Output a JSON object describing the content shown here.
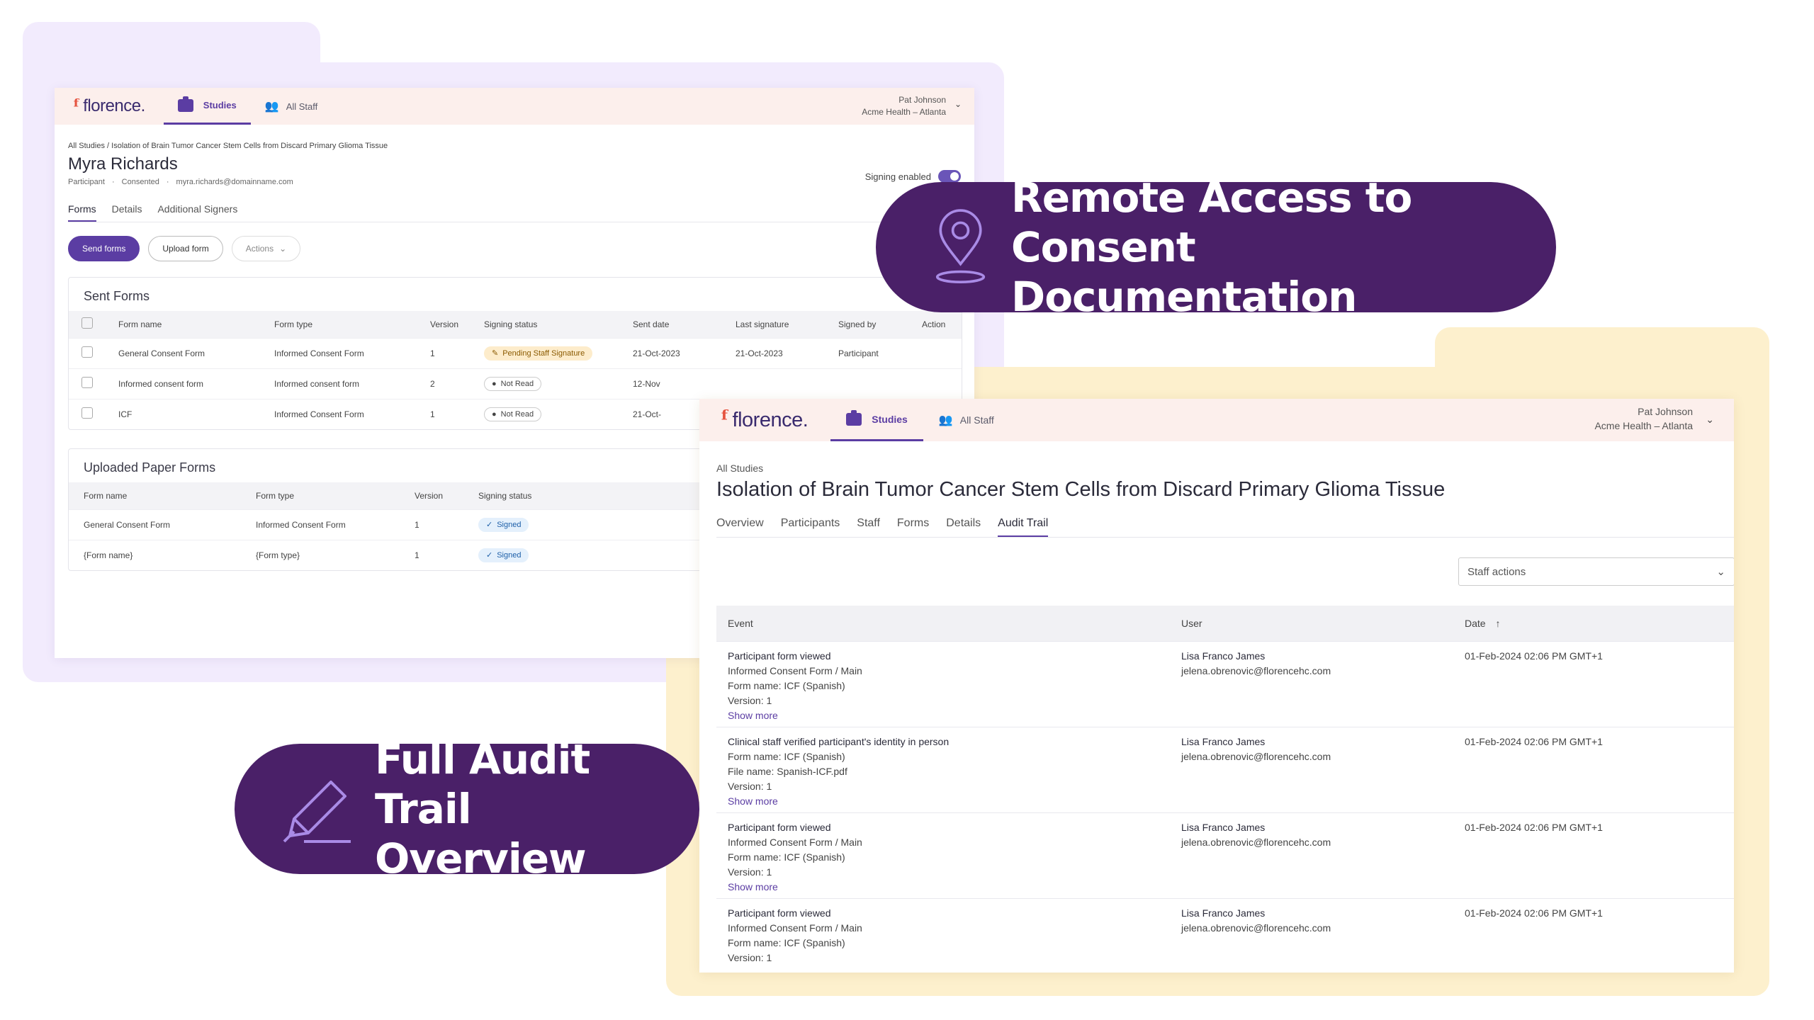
{
  "callouts": {
    "remote_line1": "Remote Access to Consent",
    "remote_line2": "Documentation",
    "audit_line1": "Full Audit Trail",
    "audit_line2": "Overview"
  },
  "colors": {
    "brand_purple": "#5b3da3",
    "callout_bg": "#4a2068",
    "header_bg": "#fcefec",
    "backdrop_purple": "#f2ebfd",
    "backdrop_yellow": "#fdf0cd"
  },
  "participant_window": {
    "logo": "florence.",
    "tabs": {
      "studies": "Studies",
      "staff": "All Staff"
    },
    "user": {
      "name": "Pat Johnson",
      "org": "Acme Health – Atlanta"
    },
    "breadcrumb": "All Studies / Isolation of Brain Tumor Cancer Stem Cells from Discard Primary Glioma Tissue",
    "name": "Myra Richards",
    "meta": [
      "Participant",
      "Consented",
      "myra.richards@domainname.com"
    ],
    "meta_sep": "·",
    "signing_label": "Signing enabled",
    "subtabs": [
      "Forms",
      "Details",
      "Additional Signers"
    ],
    "buttons": {
      "send": "Send forms",
      "upload": "Upload form",
      "actions": "Actions"
    },
    "sent_forms": {
      "title": "Sent Forms",
      "headers": [
        "Form name",
        "Form type",
        "Version",
        "Signing status",
        "Sent date",
        "Last signature",
        "Signed by",
        "Action"
      ],
      "rows": [
        {
          "name": "General Consent Form",
          "type": "Informed Consent Form",
          "version": "1",
          "status": "Pending Staff Signature",
          "sent": "21-Oct-2023",
          "last": "21-Oct-2023",
          "signed_by": "Participant"
        },
        {
          "name": "Informed consent form",
          "type": "Informed consent form",
          "version": "2",
          "status": "Not Read",
          "sent": "12-Nov",
          "last": "",
          "signed_by": ""
        },
        {
          "name": "ICF",
          "type": "Informed Consent Form",
          "version": "1",
          "status": "Not Read",
          "sent": "21-Oct-",
          "last": "",
          "signed_by": ""
        }
      ]
    },
    "uploaded_forms": {
      "title": "Uploaded Paper Forms",
      "headers": [
        "Form name",
        "Form type",
        "Version",
        "Signing status"
      ],
      "rows": [
        {
          "name": "General Consent Form",
          "type": "Informed Consent Form",
          "version": "1",
          "status": "Signed"
        },
        {
          "name": "{Form name}",
          "type": "{Form type}",
          "version": "1",
          "status": "Signed"
        }
      ]
    }
  },
  "study_window": {
    "logo": "florence.",
    "tabs": {
      "studies": "Studies",
      "staff": "All Staff"
    },
    "user": {
      "name": "Pat Johnson",
      "org": "Acme Health – Atlanta"
    },
    "breadcrumb": "All Studies",
    "title": "Isolation of Brain Tumor Cancer Stem Cells from Discard Primary Glioma Tissue",
    "tabs_list": [
      "Overview",
      "Participants",
      "Staff",
      "Forms",
      "Details",
      "Audit Trail"
    ],
    "active_tab": "Audit Trail",
    "staff_actions": "Staff actions",
    "audit": {
      "headers": {
        "event": "Event",
        "user": "User",
        "date": "Date"
      },
      "rows": [
        {
          "event": "Participant form viewed",
          "lines": [
            "Informed Consent Form / Main",
            "Form name: ICF (Spanish)",
            "Version: 1"
          ],
          "more": "Show more",
          "user": "Lisa Franco James",
          "email": "jelena.obrenovic@florencehc.com",
          "date": "01-Feb-2024 02:06 PM GMT+1"
        },
        {
          "event": "Clinical staff verified participant's identity in person",
          "lines": [
            "Form name: ICF (Spanish)",
            "File name: Spanish-ICF.pdf",
            "Version: 1"
          ],
          "more": "Show more",
          "user": "Lisa Franco James",
          "email": "jelena.obrenovic@florencehc.com",
          "date": "01-Feb-2024 02:06 PM GMT+1"
        },
        {
          "event": "Participant form viewed",
          "lines": [
            "Informed Consent Form / Main",
            "Form name: ICF (Spanish)",
            "Version: 1"
          ],
          "more": "Show more",
          "user": "Lisa Franco James",
          "email": "jelena.obrenovic@florencehc.com",
          "date": "01-Feb-2024 02:06 PM GMT+1"
        },
        {
          "event": "Participant form viewed",
          "lines": [
            "Informed Consent Form / Main",
            "Form name: ICF (Spanish)",
            "Version: 1"
          ],
          "more": "",
          "user": "Lisa Franco James",
          "email": "jelena.obrenovic@florencehc.com",
          "date": "01-Feb-2024 02:06 PM GMT+1"
        }
      ]
    }
  }
}
